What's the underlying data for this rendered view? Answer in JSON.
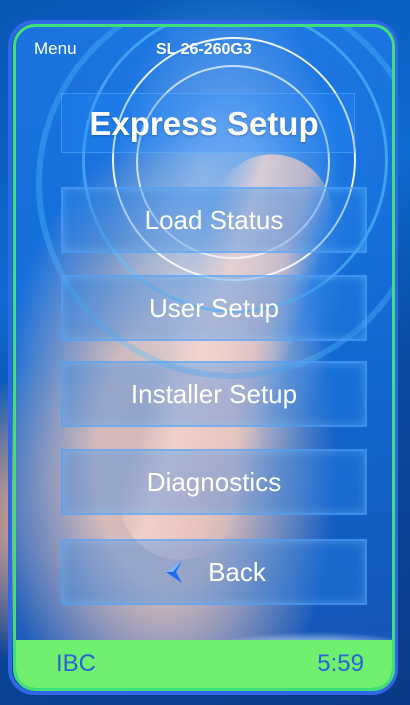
{
  "header": {
    "menu_label": "Menu",
    "model": "SL 26-260G3"
  },
  "screen": {
    "title": "Express Setup"
  },
  "menu": {
    "load_status": "Load Status",
    "user_setup": "User Setup",
    "installer_setup": "Installer Setup",
    "diagnostics": "Diagnostics",
    "back": "Back"
  },
  "status_bar": {
    "left": "IBC",
    "right": "5:59"
  },
  "colors": {
    "frame_outer": "#2f67e6",
    "frame_inner": "#3fe07a",
    "status_bar": "#6ef06e",
    "status_text": "#2a62d8",
    "back_arrow": "#1e6cf0"
  },
  "icons": {
    "back": "chevron-left-icon"
  }
}
